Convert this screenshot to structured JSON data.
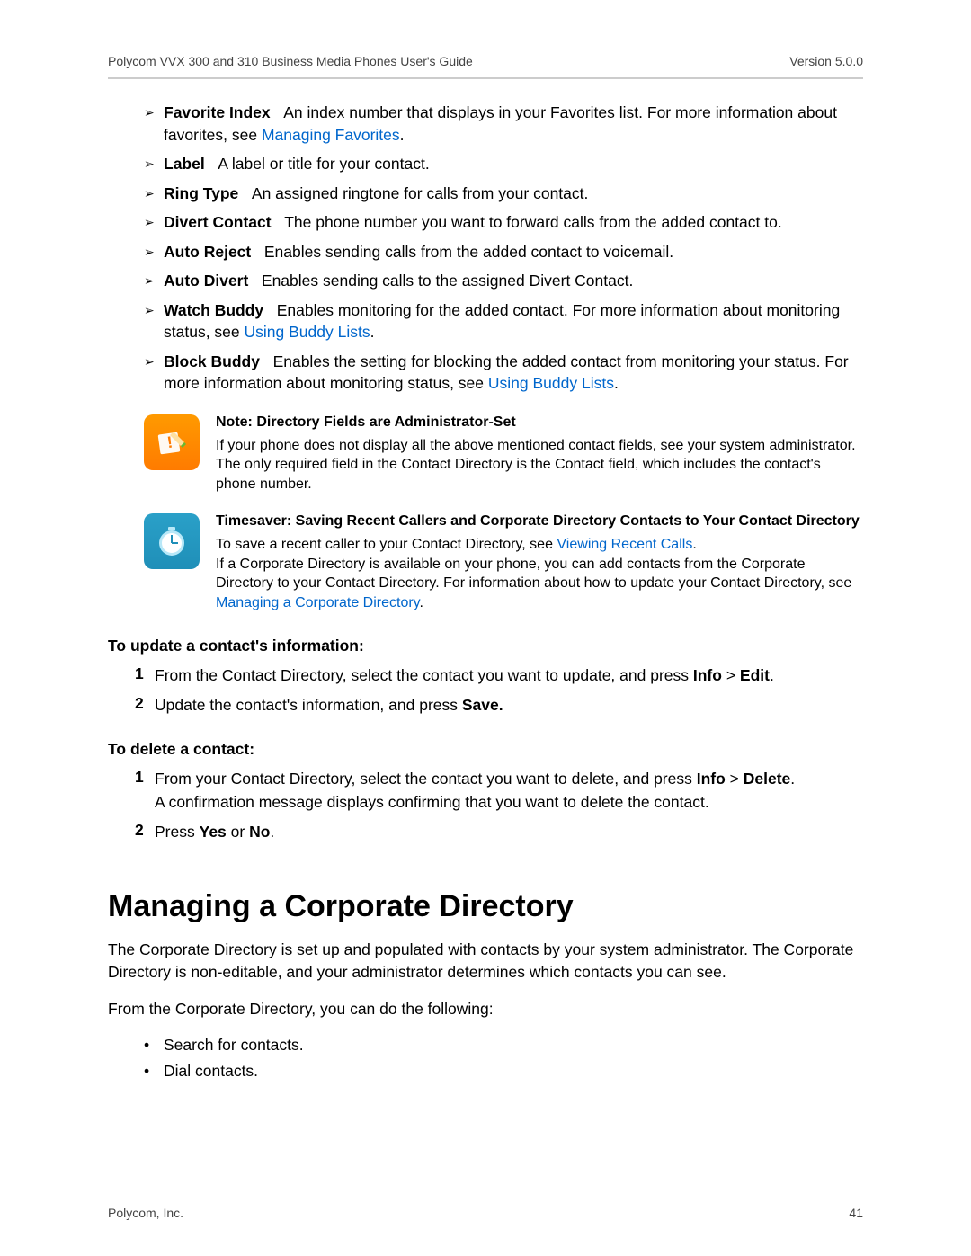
{
  "header": {
    "left": "Polycom VVX 300 and 310 Business Media Phones User's Guide",
    "right": "Version 5.0.0"
  },
  "bullets": [
    {
      "term": "Favorite Index",
      "text_before": "An index number that displays in your Favorites list. For more information about favorites, see ",
      "link": "Managing Favorites",
      "text_after": "."
    },
    {
      "term": "Label",
      "text_before": "A label or title for your contact."
    },
    {
      "term": "Ring Type",
      "text_before": "An assigned ringtone for calls from your contact."
    },
    {
      "term": "Divert Contact",
      "text_before": "The phone number you want to forward calls from the added contact to."
    },
    {
      "term": "Auto Reject",
      "text_before": "Enables sending calls from the added contact to voicemail."
    },
    {
      "term": "Auto Divert",
      "text_before": "Enables sending calls to the assigned Divert Contact."
    },
    {
      "term": "Watch Buddy",
      "text_before": "Enables monitoring for the added contact. For more information about monitoring status, see ",
      "link": "Using Buddy Lists",
      "text_after": "."
    },
    {
      "term": "Block Buddy",
      "text_before": "Enables the setting for blocking the added contact from monitoring your status. For more information about monitoring status, see ",
      "link": "Using Buddy Lists",
      "text_after": "."
    }
  ],
  "note": {
    "title": "Note: Directory Fields are Administrator-Set",
    "text": "If your phone does not display all the above mentioned contact fields, see your system administrator. The only required field in the Contact Directory is the Contact field, which includes the contact's phone number."
  },
  "timesaver": {
    "title": "Timesaver: Saving Recent Callers and Corporate Directory Contacts to Your Contact Directory",
    "line1_prefix": "To save a recent caller to your Contact Directory, see ",
    "link1": "Viewing Recent Calls",
    "line1_suffix": ".",
    "line2_prefix": "If a Corporate Directory is available on your phone, you can add contacts from the Corporate Directory to your Contact Directory. For information about how to update your Contact Directory, see ",
    "link2": "Managing a Corporate Directory",
    "line2_suffix": "."
  },
  "update_head": "To update a contact's information:",
  "update_steps": [
    {
      "n": "1",
      "pre": "From the Contact Directory, select the contact you want to update, and press ",
      "b1": "Info",
      "mid": " > ",
      "b2": "Edit",
      "post": "."
    },
    {
      "n": "2",
      "pre": "Update the contact's information, and press ",
      "b1": "Save.",
      "mid": "",
      "b2": "",
      "post": ""
    }
  ],
  "delete_head": "To delete a contact:",
  "delete_steps": [
    {
      "n": "1",
      "pre": "From your Contact Directory, select the contact you want to delete, and press ",
      "b1": "Info",
      "mid": " > ",
      "b2": "Delete",
      "post": ".",
      "extra": "A confirmation message displays confirming that you want to delete the contact."
    },
    {
      "n": "2",
      "pre": "Press ",
      "b1": "Yes",
      "mid": " or ",
      "b2": "No",
      "post": "."
    }
  ],
  "section_title": "Managing a Corporate Directory",
  "section_para1": "The Corporate Directory is set up and populated with contacts by your system administrator. The Corporate Directory is non-editable, and your administrator determines which contacts you can see.",
  "section_para2": "From the Corporate Directory, you can do the following:",
  "dots": [
    "Search for contacts.",
    "Dial contacts."
  ],
  "footer": {
    "left": "Polycom, Inc.",
    "right": "41"
  }
}
